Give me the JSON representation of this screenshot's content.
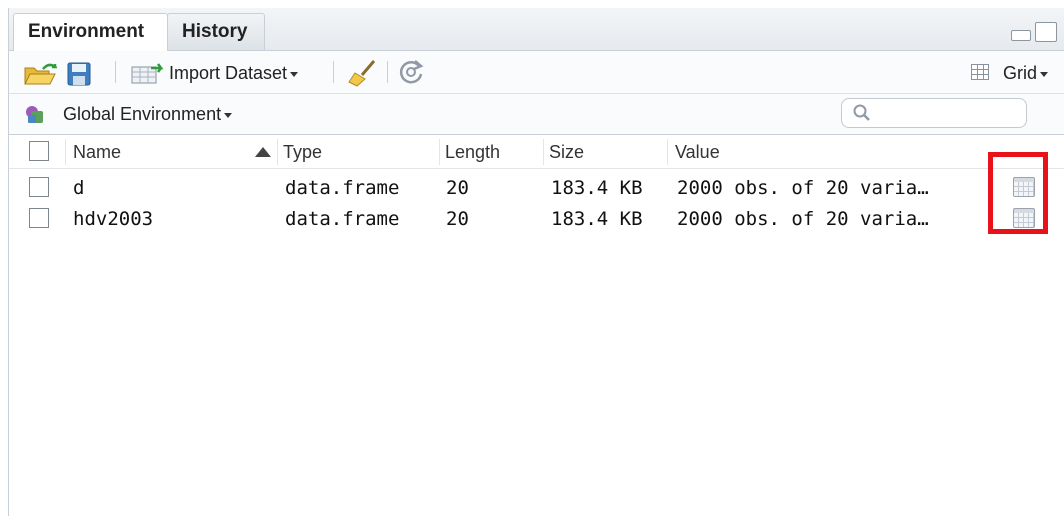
{
  "tabs": [
    {
      "label": "Environment",
      "active": true
    },
    {
      "label": "History",
      "active": false
    }
  ],
  "toolbar": {
    "import_label": "Import Dataset",
    "view_label": "Grid"
  },
  "env": {
    "scope_label": "Global Environment",
    "search_placeholder": ""
  },
  "table": {
    "headers": {
      "name": "Name",
      "type": "Type",
      "length": "Length",
      "size": "Size",
      "value": "Value"
    },
    "sort_column": "name",
    "rows": [
      {
        "name": "d",
        "type": "data.frame",
        "length": "20",
        "size": "183.4 KB",
        "value": "2000 obs. of 20 varia…"
      },
      {
        "name": "hdv2003",
        "type": "data.frame",
        "length": "20",
        "size": "183.4 KB",
        "value": "2000 obs. of 20 varia…"
      }
    ]
  },
  "colors": {
    "highlight": "#e8131a",
    "pane_border": "#c9cfd6"
  }
}
